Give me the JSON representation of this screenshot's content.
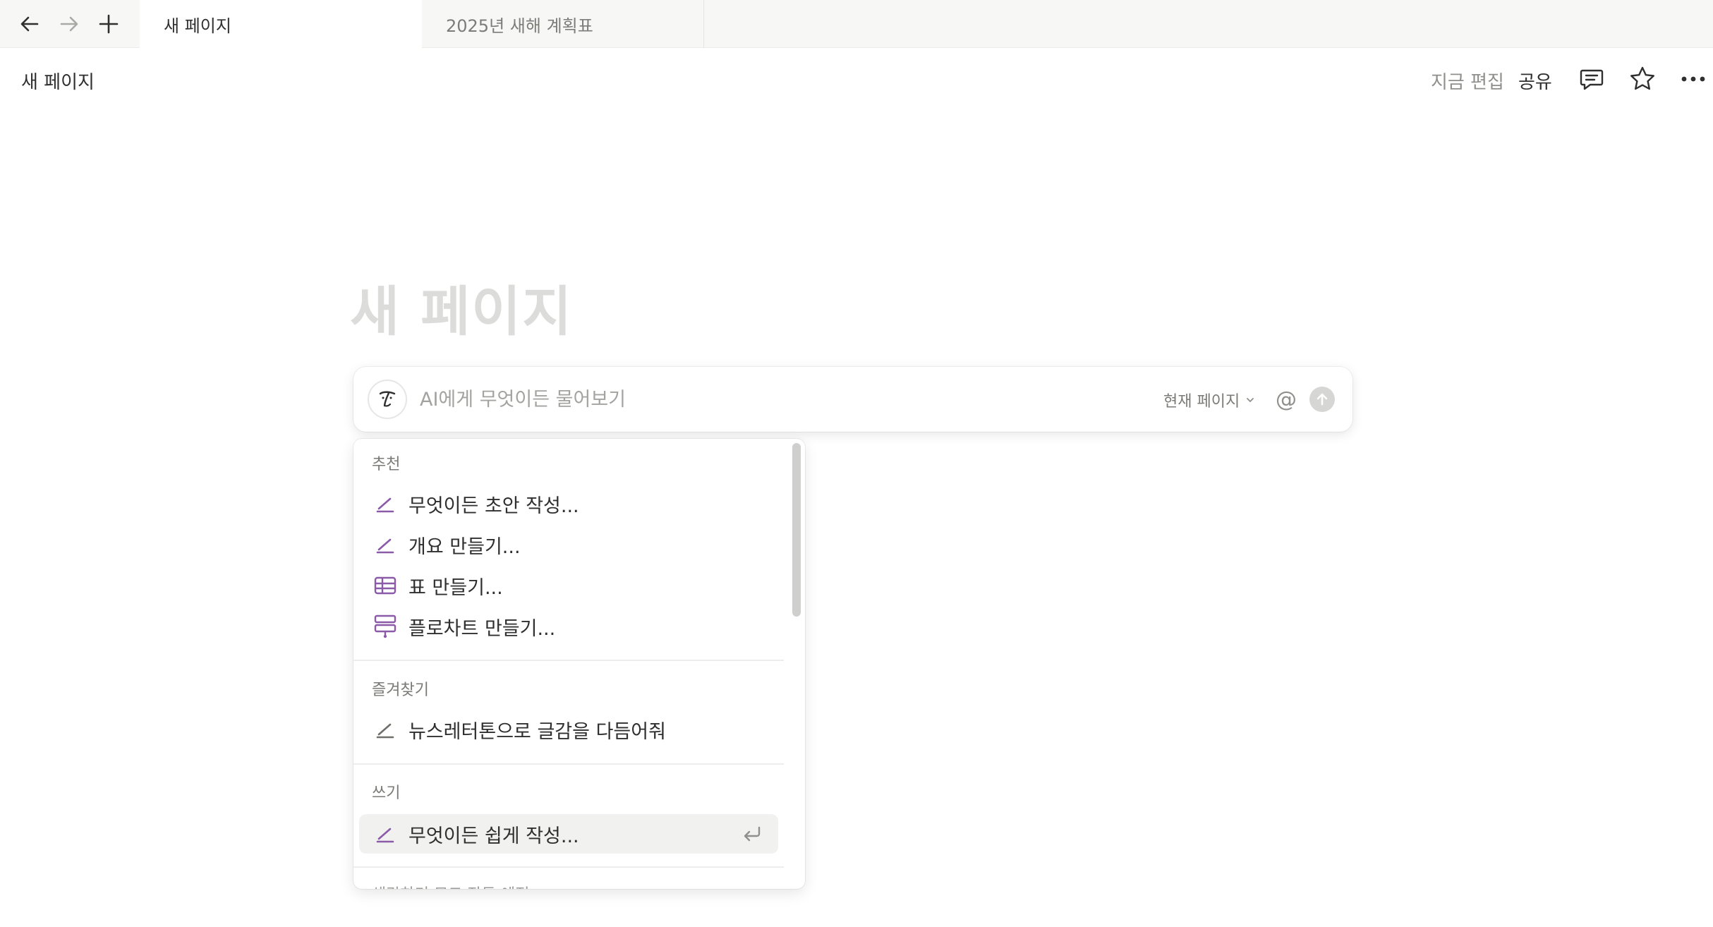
{
  "tabs": [
    {
      "label": "새 페이지",
      "active": true
    },
    {
      "label": "2025년 새해 계획표",
      "active": false
    }
  ],
  "nav": {
    "back_icon": "arrow-left-icon",
    "forward_icon": "arrow-right-icon",
    "new_tab_icon": "plus-icon"
  },
  "topbar": {
    "breadcrumb": "새 페이지",
    "edit_status": "지금 편집",
    "share_label": "공유",
    "icons": [
      "comment-icon",
      "star-icon",
      "more-icon"
    ]
  },
  "page": {
    "title": "새 페이지"
  },
  "ai_bar": {
    "placeholder": "AI에게 무엇이든 물어보기",
    "scope_label": "현재 페이지",
    "mention_symbol": "@"
  },
  "menu": {
    "sections": [
      {
        "label": "추천",
        "items": [
          {
            "label": "무엇이든 초안 작성...",
            "icon": "pencil-icon"
          },
          {
            "label": "개요 만들기...",
            "icon": "pencil-icon"
          },
          {
            "label": "표 만들기...",
            "icon": "table-icon"
          },
          {
            "label": "플로차트 만들기...",
            "icon": "flowchart-icon"
          }
        ]
      },
      {
        "label": "즐겨찾기",
        "items": [
          {
            "label": "뉴스레터톤으로 글감을 다듬어줘",
            "icon": "pencil-icon"
          }
        ]
      },
      {
        "label": "쓰기",
        "items": [
          {
            "label": "무엇이든 쉽게 작성...",
            "icon": "pencil-icon",
            "selected": true
          }
        ]
      }
    ],
    "next_section_partial": "생각하기 모드 작동 예정"
  },
  "colors": {
    "accent_purple": "#8b5aa8",
    "tabbar_bg": "#f7f7f5",
    "placeholder_gray": "#a3a3a0"
  }
}
